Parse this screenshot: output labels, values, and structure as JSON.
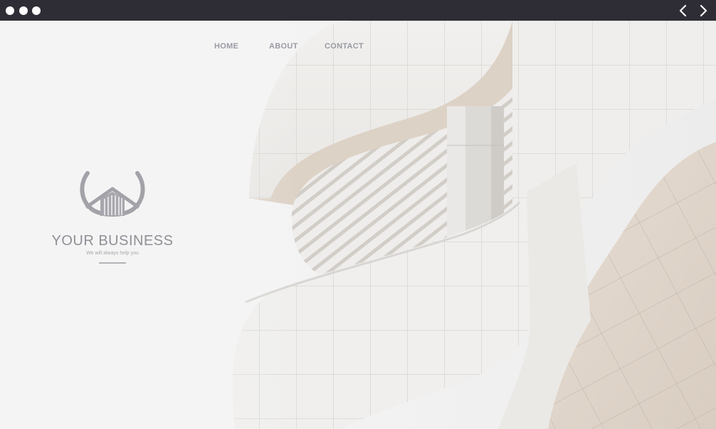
{
  "window": {
    "controls": [
      "close",
      "minimize",
      "maximize"
    ],
    "back_icon": "chevron-left-icon",
    "forward_icon": "chevron-right-icon"
  },
  "nav": {
    "home": "HOME",
    "about": "ABOUT",
    "contact": "CONTACT"
  },
  "brand": {
    "name": "YOUR BUSINESS",
    "tagline": "We will always help you",
    "logo_icon": "house-in-laurel-icon"
  },
  "hero": {
    "image": "white-curved-architecture-photo"
  },
  "colors": {
    "titlebar": "#2e2d35",
    "nav_text": "#9a9ba5",
    "brand_text": "#8f8f96",
    "background": "#f4f4f4"
  }
}
